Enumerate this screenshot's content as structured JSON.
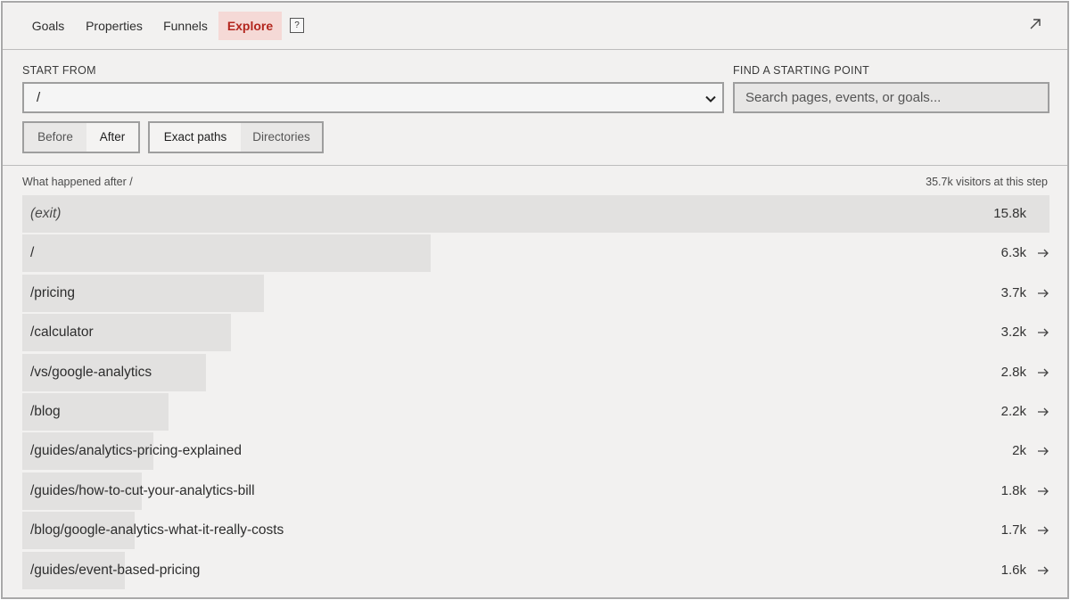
{
  "nav": {
    "tabs": [
      {
        "label": "Goals",
        "active": false
      },
      {
        "label": "Properties",
        "active": false
      },
      {
        "label": "Funnels",
        "active": false
      },
      {
        "label": "Explore",
        "active": true
      }
    ],
    "help_label": "?",
    "expand_icon": "arrow-up-right-icon"
  },
  "controls": {
    "start_from_label": "START FROM",
    "start_from_value": "/",
    "find_label": "FIND A STARTING POINT",
    "search_placeholder": "Search pages, events, or goals...",
    "direction": {
      "options": [
        "Before",
        "After"
      ],
      "selected": "After"
    },
    "path_mode": {
      "options": [
        "Exact paths",
        "Directories"
      ],
      "selected": "Exact paths"
    }
  },
  "results": {
    "heading": "What happened after /",
    "visitors_summary": "35.7k visitors at this step",
    "rows": [
      {
        "name": "(exit)",
        "count": "15.8k",
        "share": 1.0,
        "exit": true
      },
      {
        "name": "/",
        "count": "6.3k",
        "share": 0.3976
      },
      {
        "name": "/pricing",
        "count": "3.7k",
        "share": 0.2352
      },
      {
        "name": "/calculator",
        "count": "3.2k",
        "share": 0.2031
      },
      {
        "name": "/vs/google-analytics",
        "count": "2.8k",
        "share": 0.1788
      },
      {
        "name": "/blog",
        "count": "2.2k",
        "share": 0.1424
      },
      {
        "name": "/guides/analytics-pricing-explained",
        "count": "2k",
        "share": 0.128
      },
      {
        "name": "/guides/how-to-cut-your-analytics-bill",
        "count": "1.8k",
        "share": 0.1163
      },
      {
        "name": "/blog/google-analytics-what-it-really-costs",
        "count": "1.7k",
        "share": 0.1094
      },
      {
        "name": "/guides/event-based-pricing",
        "count": "1.6k",
        "share": 0.0998
      }
    ]
  },
  "colors": {
    "accent": "#b3261e",
    "accent_bg": "#f5d9d6",
    "bar": "#e2e1e0",
    "panel": "#f2f1f0"
  }
}
